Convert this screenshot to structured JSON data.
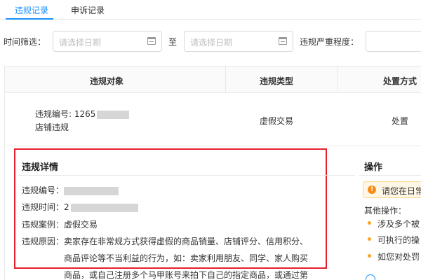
{
  "tabs": [
    {
      "label": "违规记录",
      "active": true
    },
    {
      "label": "申诉记录",
      "active": false
    }
  ],
  "filter": {
    "time_label": "时间筛选：",
    "start_placeholder": "请选择日期",
    "to_label": "至",
    "end_placeholder": "请选择日期",
    "severity_label": "违规严重程度："
  },
  "table": {
    "headers": [
      "违规对象",
      "违规类型",
      "处置方式"
    ],
    "row": {
      "id_prefix": "违规编号: 1265",
      "object": "店铺违规",
      "type": "虚假交易",
      "action": "处置"
    }
  },
  "detail": {
    "title": "违规详情",
    "id_label": "违规编号：",
    "time_label": "违规时间：2",
    "case_label": "违规案例：",
    "case_value": "虚假交易",
    "reason_label": "违规原因：",
    "reason_line1": "卖家存在非常规方式获得虚假的商品销量、店铺评分、信用积分、",
    "reason_line2": "商品评论等不当利益的行为，如：卖家利用朋友、同学、家人购买",
    "reason_line3": "商品，或自己注册多个马甲账号来拍下自己的指定商品，或通过第"
  },
  "operations": {
    "title": "操作",
    "notice": "请您在日常",
    "other_label": "其他操作：",
    "items": [
      "涉及多个被",
      "可执行的操",
      "如您对处罚"
    ]
  },
  "colors": {
    "accent": "#1890ff",
    "highlight_box": "#e5202d",
    "notice_bg": "#fff7e6",
    "bullet": "#f5a623"
  }
}
